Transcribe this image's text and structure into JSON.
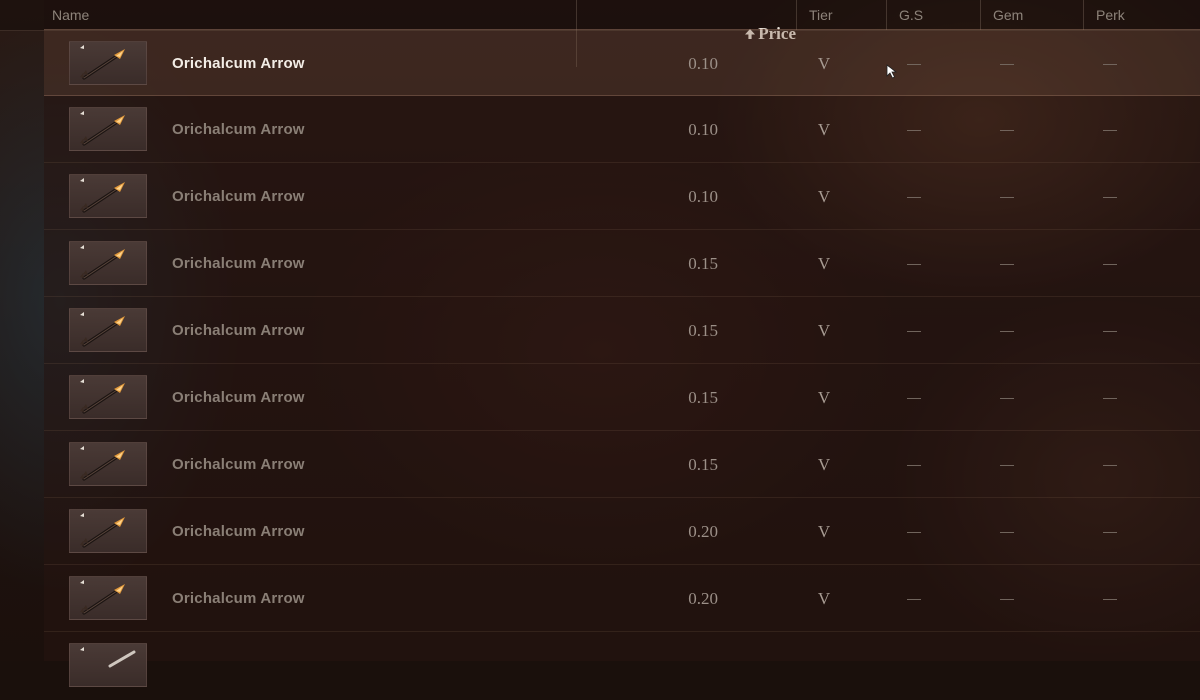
{
  "columns": {
    "name": "Name",
    "price": "Price",
    "tier": "Tier",
    "gs": "G.S",
    "gem": "Gem",
    "perk": "Perk"
  },
  "sort": {
    "column": "price",
    "direction": "ascending",
    "icon": "sort-up-arrow-icon"
  },
  "rows": [
    {
      "name": "Orichalcum Arrow",
      "price": "0.10",
      "tier": "V",
      "gs": "—",
      "gem": "—",
      "perk": "—",
      "selected": true
    },
    {
      "name": "Orichalcum Arrow",
      "price": "0.10",
      "tier": "V",
      "gs": "—",
      "gem": "—",
      "perk": "—"
    },
    {
      "name": "Orichalcum Arrow",
      "price": "0.10",
      "tier": "V",
      "gs": "—",
      "gem": "—",
      "perk": "—"
    },
    {
      "name": "Orichalcum Arrow",
      "price": "0.15",
      "tier": "V",
      "gs": "—",
      "gem": "—",
      "perk": "—"
    },
    {
      "name": "Orichalcum Arrow",
      "price": "0.15",
      "tier": "V",
      "gs": "—",
      "gem": "—",
      "perk": "—"
    },
    {
      "name": "Orichalcum Arrow",
      "price": "0.15",
      "tier": "V",
      "gs": "—",
      "gem": "—",
      "perk": "—"
    },
    {
      "name": "Orichalcum Arrow",
      "price": "0.15",
      "tier": "V",
      "gs": "—",
      "gem": "—",
      "perk": "—"
    },
    {
      "name": "Orichalcum Arrow",
      "price": "0.20",
      "tier": "V",
      "gs": "—",
      "gem": "—",
      "perk": "—"
    },
    {
      "name": "Orichalcum Arrow",
      "price": "0.20",
      "tier": "V",
      "gs": "—",
      "gem": "—",
      "perk": "—"
    }
  ],
  "item_icon": "arrow-item-icon",
  "colors": {
    "selected_text": "#f3ede6",
    "row_text": "#8a7f76",
    "header_text": "#8d837a"
  }
}
